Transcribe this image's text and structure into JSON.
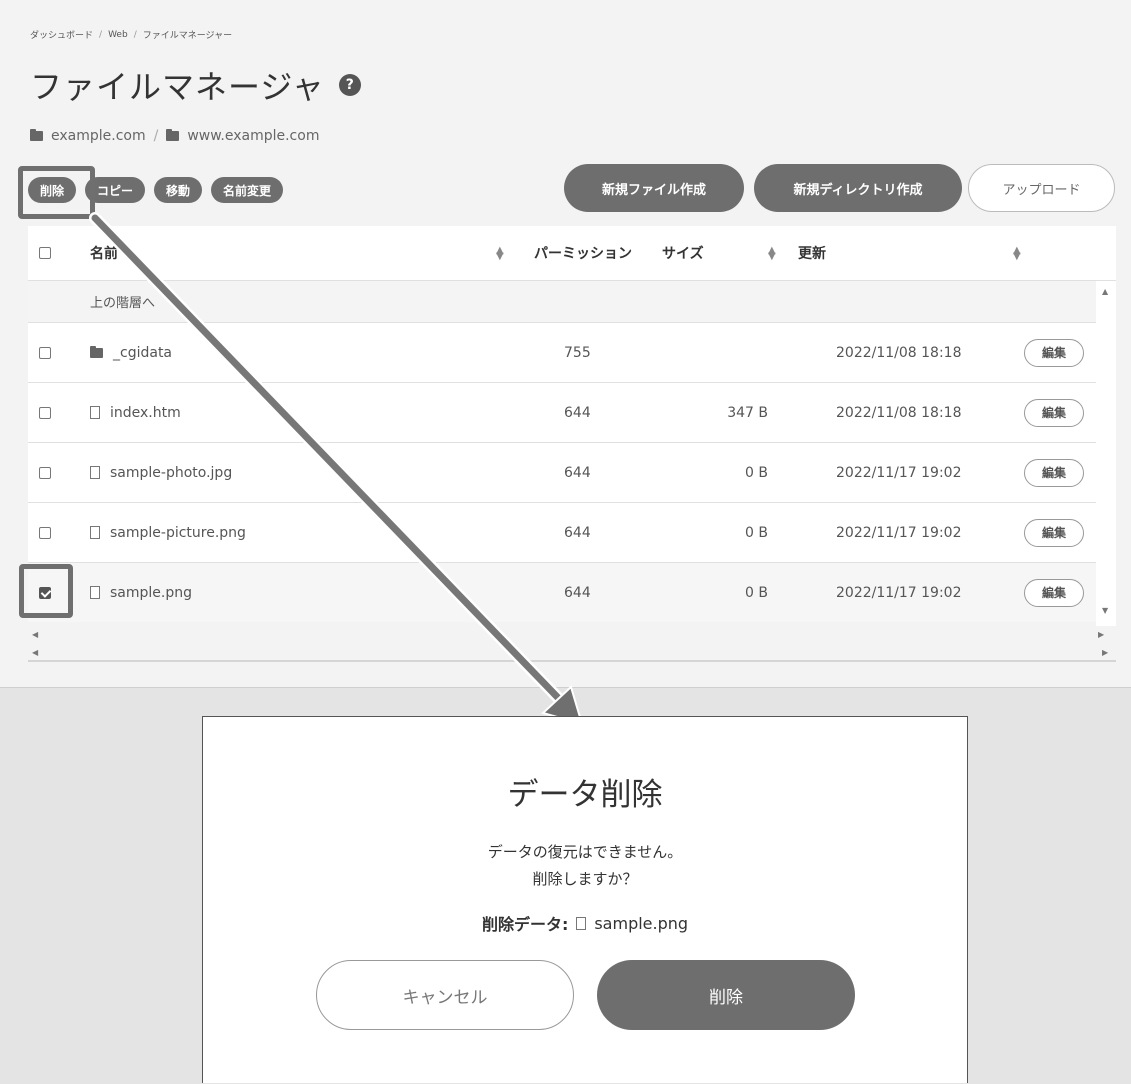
{
  "breadcrumb": [
    "ダッシュボード",
    "Web",
    "ファイルマネージャー"
  ],
  "breadcrumb_sep": "/",
  "page_title": "ファイルマネージャ",
  "help_icon": "?",
  "path": [
    "example.com",
    "www.example.com"
  ],
  "actions": {
    "delete": "削除",
    "copy": "コピー",
    "move": "移動",
    "rename": "名前変更",
    "new_file": "新規ファイル作成",
    "new_dir": "新規ディレクトリ作成",
    "upload": "アップロード"
  },
  "table": {
    "headers": {
      "name": "名前",
      "permission": "パーミッション",
      "size": "サイズ",
      "updated": "更新"
    },
    "parent_label": "上の階層へ",
    "edit_label": "編集",
    "rows": [
      {
        "name": "_cgidata",
        "type": "folder",
        "permission": "755",
        "size": "",
        "updated": "2022/11/08 18:18",
        "checked": false
      },
      {
        "name": "index.htm",
        "type": "file",
        "permission": "644",
        "size": "347 B",
        "updated": "2022/11/08 18:18",
        "checked": false
      },
      {
        "name": "sample-photo.jpg",
        "type": "file",
        "permission": "644",
        "size": "0 B",
        "updated": "2022/11/17 19:02",
        "checked": false
      },
      {
        "name": "sample-picture.png",
        "type": "file",
        "permission": "644",
        "size": "0 B",
        "updated": "2022/11/17 19:02",
        "checked": false
      },
      {
        "name": "sample.png",
        "type": "file",
        "permission": "644",
        "size": "0 B",
        "updated": "2022/11/17 19:02",
        "checked": true
      }
    ]
  },
  "dialog": {
    "title": "データ削除",
    "message_line1": "データの復元はできません。",
    "message_line2": "削除しますか？",
    "target_label": "削除データ:",
    "target_file": "sample.png",
    "cancel": "キャンセル",
    "delete": "削除"
  },
  "colors": {
    "button_dark": "#6e6e6e",
    "highlight": "#6f6f6f",
    "panel_bg": "#f3f3f3"
  }
}
